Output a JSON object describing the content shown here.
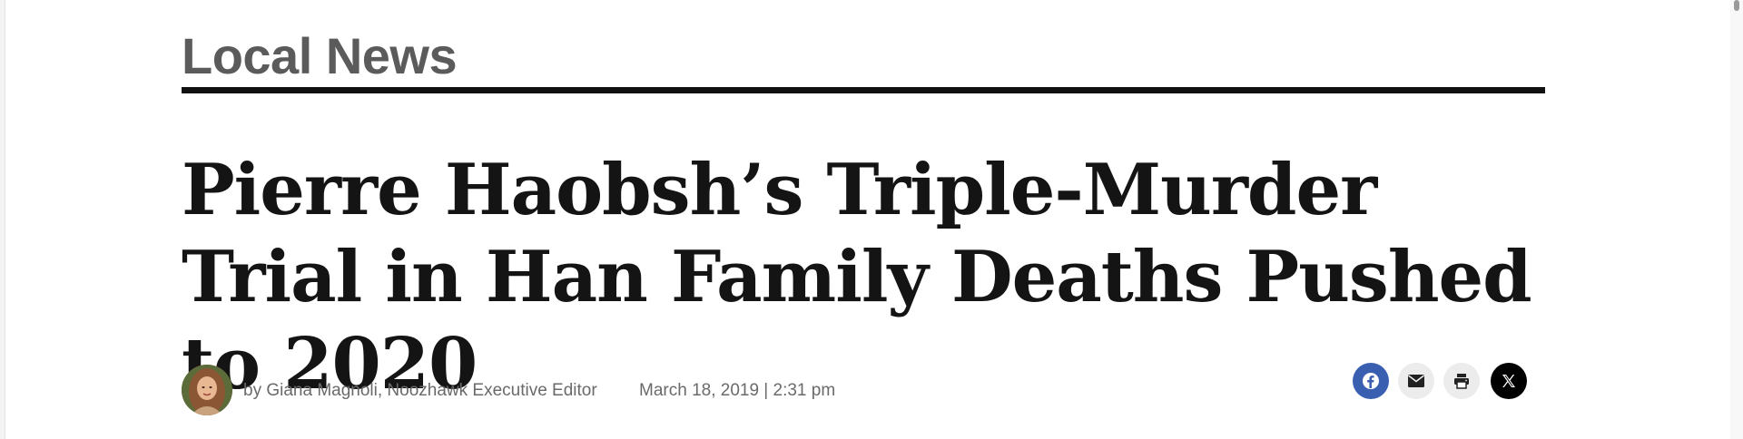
{
  "section": {
    "label": "Local News"
  },
  "article": {
    "headline": "Pierre Haobsh’s Triple-Murder Trial in Han Family Deaths Pushed to 2020",
    "byline": "by Giana Magnoli, Noozhawk Executive Editor",
    "date": "March 18, 2019 | 2:31 pm"
  },
  "share": {
    "buttons": [
      {
        "icon": "facebook-icon",
        "color": "#3b5fb0"
      },
      {
        "icon": "email-icon",
        "color": "#ececec"
      },
      {
        "icon": "print-icon",
        "color": "#ececec"
      },
      {
        "icon": "x-icon",
        "color": "#000000"
      }
    ]
  },
  "colors": {
    "headline": "#141414",
    "section_label": "#5b5b5b",
    "rule": "#111111",
    "meta_text": "#6a6a6a"
  }
}
